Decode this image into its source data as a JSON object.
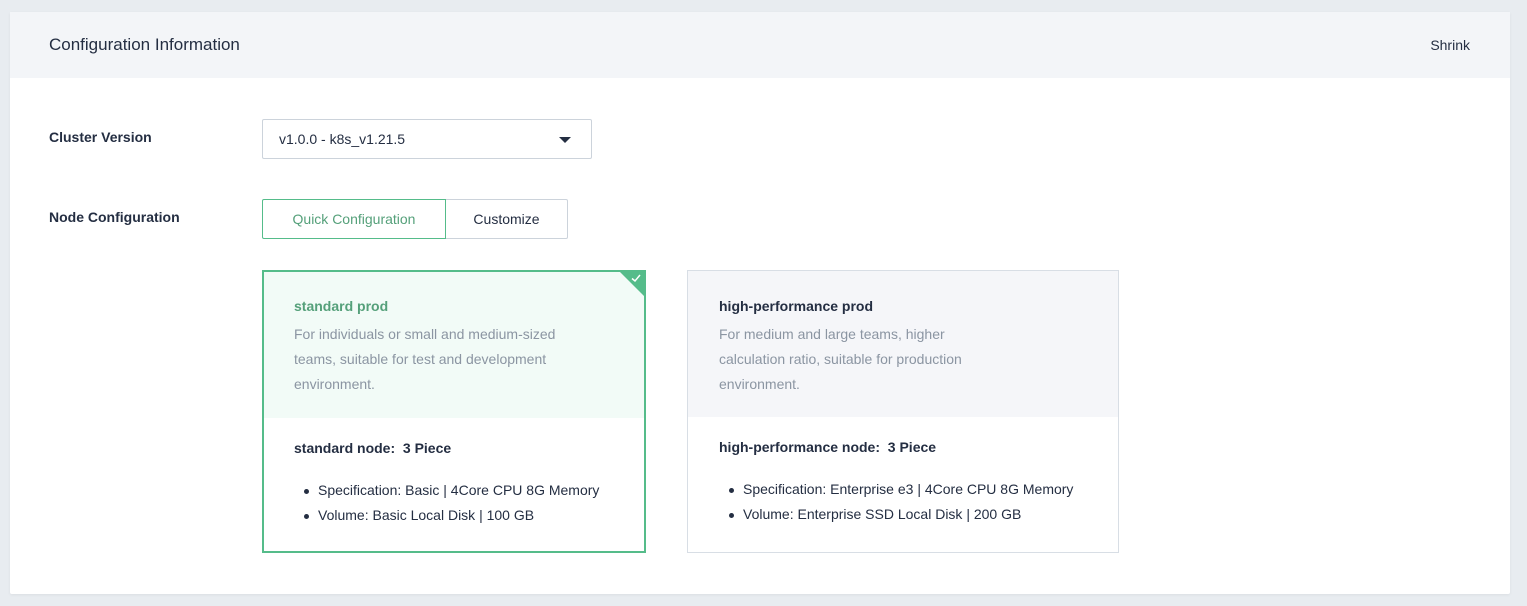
{
  "header": {
    "title": "Configuration Information",
    "shrink_label": "Shrink"
  },
  "cluster_version": {
    "label": "Cluster Version",
    "selected": "v1.0.0 - k8s_v1.21.5"
  },
  "node_configuration": {
    "label": "Node Configuration",
    "tabs": [
      {
        "label": "Quick Configuration",
        "active": true
      },
      {
        "label": "Customize",
        "active": false
      }
    ]
  },
  "cards": [
    {
      "name": "standard prod",
      "description": "For individuals or small and medium-sized teams, suitable for test and development environment.",
      "node_label": "standard node:",
      "node_count": "3 Piece",
      "specs": [
        "Specification: Basic | 4Core CPU 8G Memory",
        "Volume: Basic Local Disk | 100 GB"
      ],
      "selected": true
    },
    {
      "name": "high-performance prod",
      "description": "For medium and large teams, higher calculation ratio, suitable for production environment.",
      "node_label": "high-performance node:",
      "node_count": "3 Piece",
      "specs": [
        "Specification: Enterprise e3 | 4Core CPU 8G Memory",
        "Volume: Enterprise SSD Local Disk | 200 GB"
      ],
      "selected": false
    }
  ],
  "colors": {
    "accent": "#55bc8a",
    "text": "#242e42",
    "muted": "#8b95a2",
    "header_bg": "#f3f5f8"
  }
}
